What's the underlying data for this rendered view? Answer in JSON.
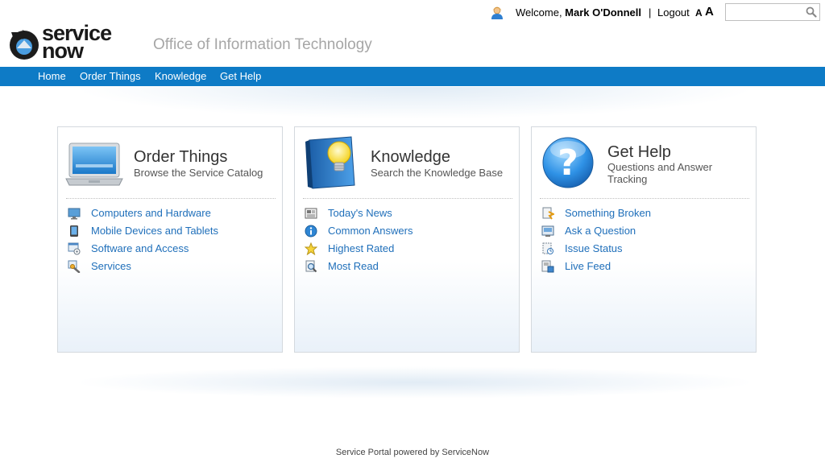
{
  "header": {
    "welcome_prefix": "Welcome, ",
    "user_name": "Mark O'Donnell",
    "separator": "|",
    "logout_label": "Logout",
    "font_small_label": "A",
    "font_large_label": "A",
    "search_placeholder": "",
    "search_value": "",
    "logo_line1": "service",
    "logo_line2": "now",
    "office_title": "Office of Information Technology"
  },
  "nav": {
    "items": [
      {
        "label": "Home"
      },
      {
        "label": "Order Things"
      },
      {
        "label": "Knowledge"
      },
      {
        "label": "Get Help"
      }
    ]
  },
  "panels": [
    {
      "title": "Order Things",
      "subtitle": "Browse the Service Catalog",
      "icon": "laptop-icon",
      "links": [
        {
          "label": "Computers and Hardware",
          "icon": "monitor-icon"
        },
        {
          "label": "Mobile Devices and Tablets",
          "icon": "tablet-icon"
        },
        {
          "label": "Software and Access",
          "icon": "software-icon"
        },
        {
          "label": "Services",
          "icon": "tools-icon"
        }
      ]
    },
    {
      "title": "Knowledge",
      "subtitle": "Search the Knowledge Base",
      "icon": "book-lightbulb-icon",
      "links": [
        {
          "label": "Today's News",
          "icon": "newspaper-icon"
        },
        {
          "label": "Common Answers",
          "icon": "info-icon"
        },
        {
          "label": "Highest Rated",
          "icon": "star-icon"
        },
        {
          "label": "Most Read",
          "icon": "magnifier-doc-icon"
        }
      ]
    },
    {
      "title": "Get Help",
      "subtitle": "Questions and Answer Tracking",
      "icon": "question-icon",
      "links": [
        {
          "label": "Something Broken",
          "icon": "broken-doc-icon"
        },
        {
          "label": "Ask a Question",
          "icon": "ask-icon"
        },
        {
          "label": "Issue Status",
          "icon": "status-icon"
        },
        {
          "label": "Live Feed",
          "icon": "feed-icon"
        }
      ]
    }
  ],
  "footer": {
    "text": "Service Portal powered by ServiceNow"
  },
  "colors": {
    "nav_bg": "#0e7bc6",
    "link": "#1f6fba",
    "office_title": "#a6a6a6"
  }
}
